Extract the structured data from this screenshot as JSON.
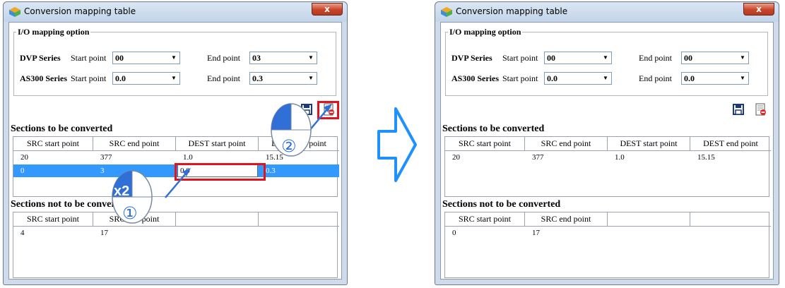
{
  "before": {
    "title": "Conversion mapping table",
    "close": "x",
    "group_title": "I/O mapping option",
    "dvp": {
      "label": "DVP Series",
      "start_label": "Start point",
      "start": "00",
      "end_label": "End point",
      "end": "03"
    },
    "as300": {
      "label": "AS300 Series",
      "start_label": "Start point",
      "start": "0.0",
      "end_label": "End point",
      "end": "0.3"
    },
    "tools": [
      "save-icon",
      "delete-section-icon"
    ],
    "convert_title": "Sections to be converted",
    "convert_headers": [
      "SRC start point",
      "SRC end point",
      "DEST start point",
      "DEST end point"
    ],
    "convert_rows": [
      [
        "20",
        "377",
        "1.0",
        "15.15"
      ],
      [
        "0",
        "3",
        "0.0",
        "0.3"
      ]
    ],
    "not_convert_title": "Sections not to be converted",
    "not_convert_headers": [
      "SRC start point",
      "SRC end point"
    ],
    "not_convert_rows": [
      [
        "4",
        "17"
      ]
    ]
  },
  "after": {
    "title": "Conversion mapping table",
    "close": "x",
    "group_title": "I/O mapping option",
    "dvp": {
      "label": "DVP Series",
      "start_label": "Start point",
      "start": "00",
      "end_label": "End point",
      "end": "00"
    },
    "as300": {
      "label": "AS300 Series",
      "start_label": "Start point",
      "start": "0.0",
      "end_label": "End point",
      "end": "0.0"
    },
    "tools": [
      "save-icon",
      "delete-section-icon"
    ],
    "convert_title": "Sections to be converted",
    "convert_headers": [
      "SRC start point",
      "SRC end point",
      "DEST start point",
      "DEST end point"
    ],
    "convert_rows": [
      [
        "20",
        "377",
        "1.0",
        "15.15"
      ]
    ],
    "not_convert_title": "Sections not to be converted",
    "not_convert_headers": [
      "SRC start point",
      "SRC end point"
    ],
    "not_convert_rows": [
      [
        "0",
        "17"
      ]
    ]
  },
  "annotations": {
    "step1": "①",
    "step2": "②",
    "double_click": "x2"
  },
  "colors": {
    "highlight_row": "#3399ff",
    "callout_red": "#e0141e",
    "pointer_blue": "#2f6fd6",
    "arrow_fill": "#ffffff",
    "arrow_stroke": "#1e90ff"
  }
}
